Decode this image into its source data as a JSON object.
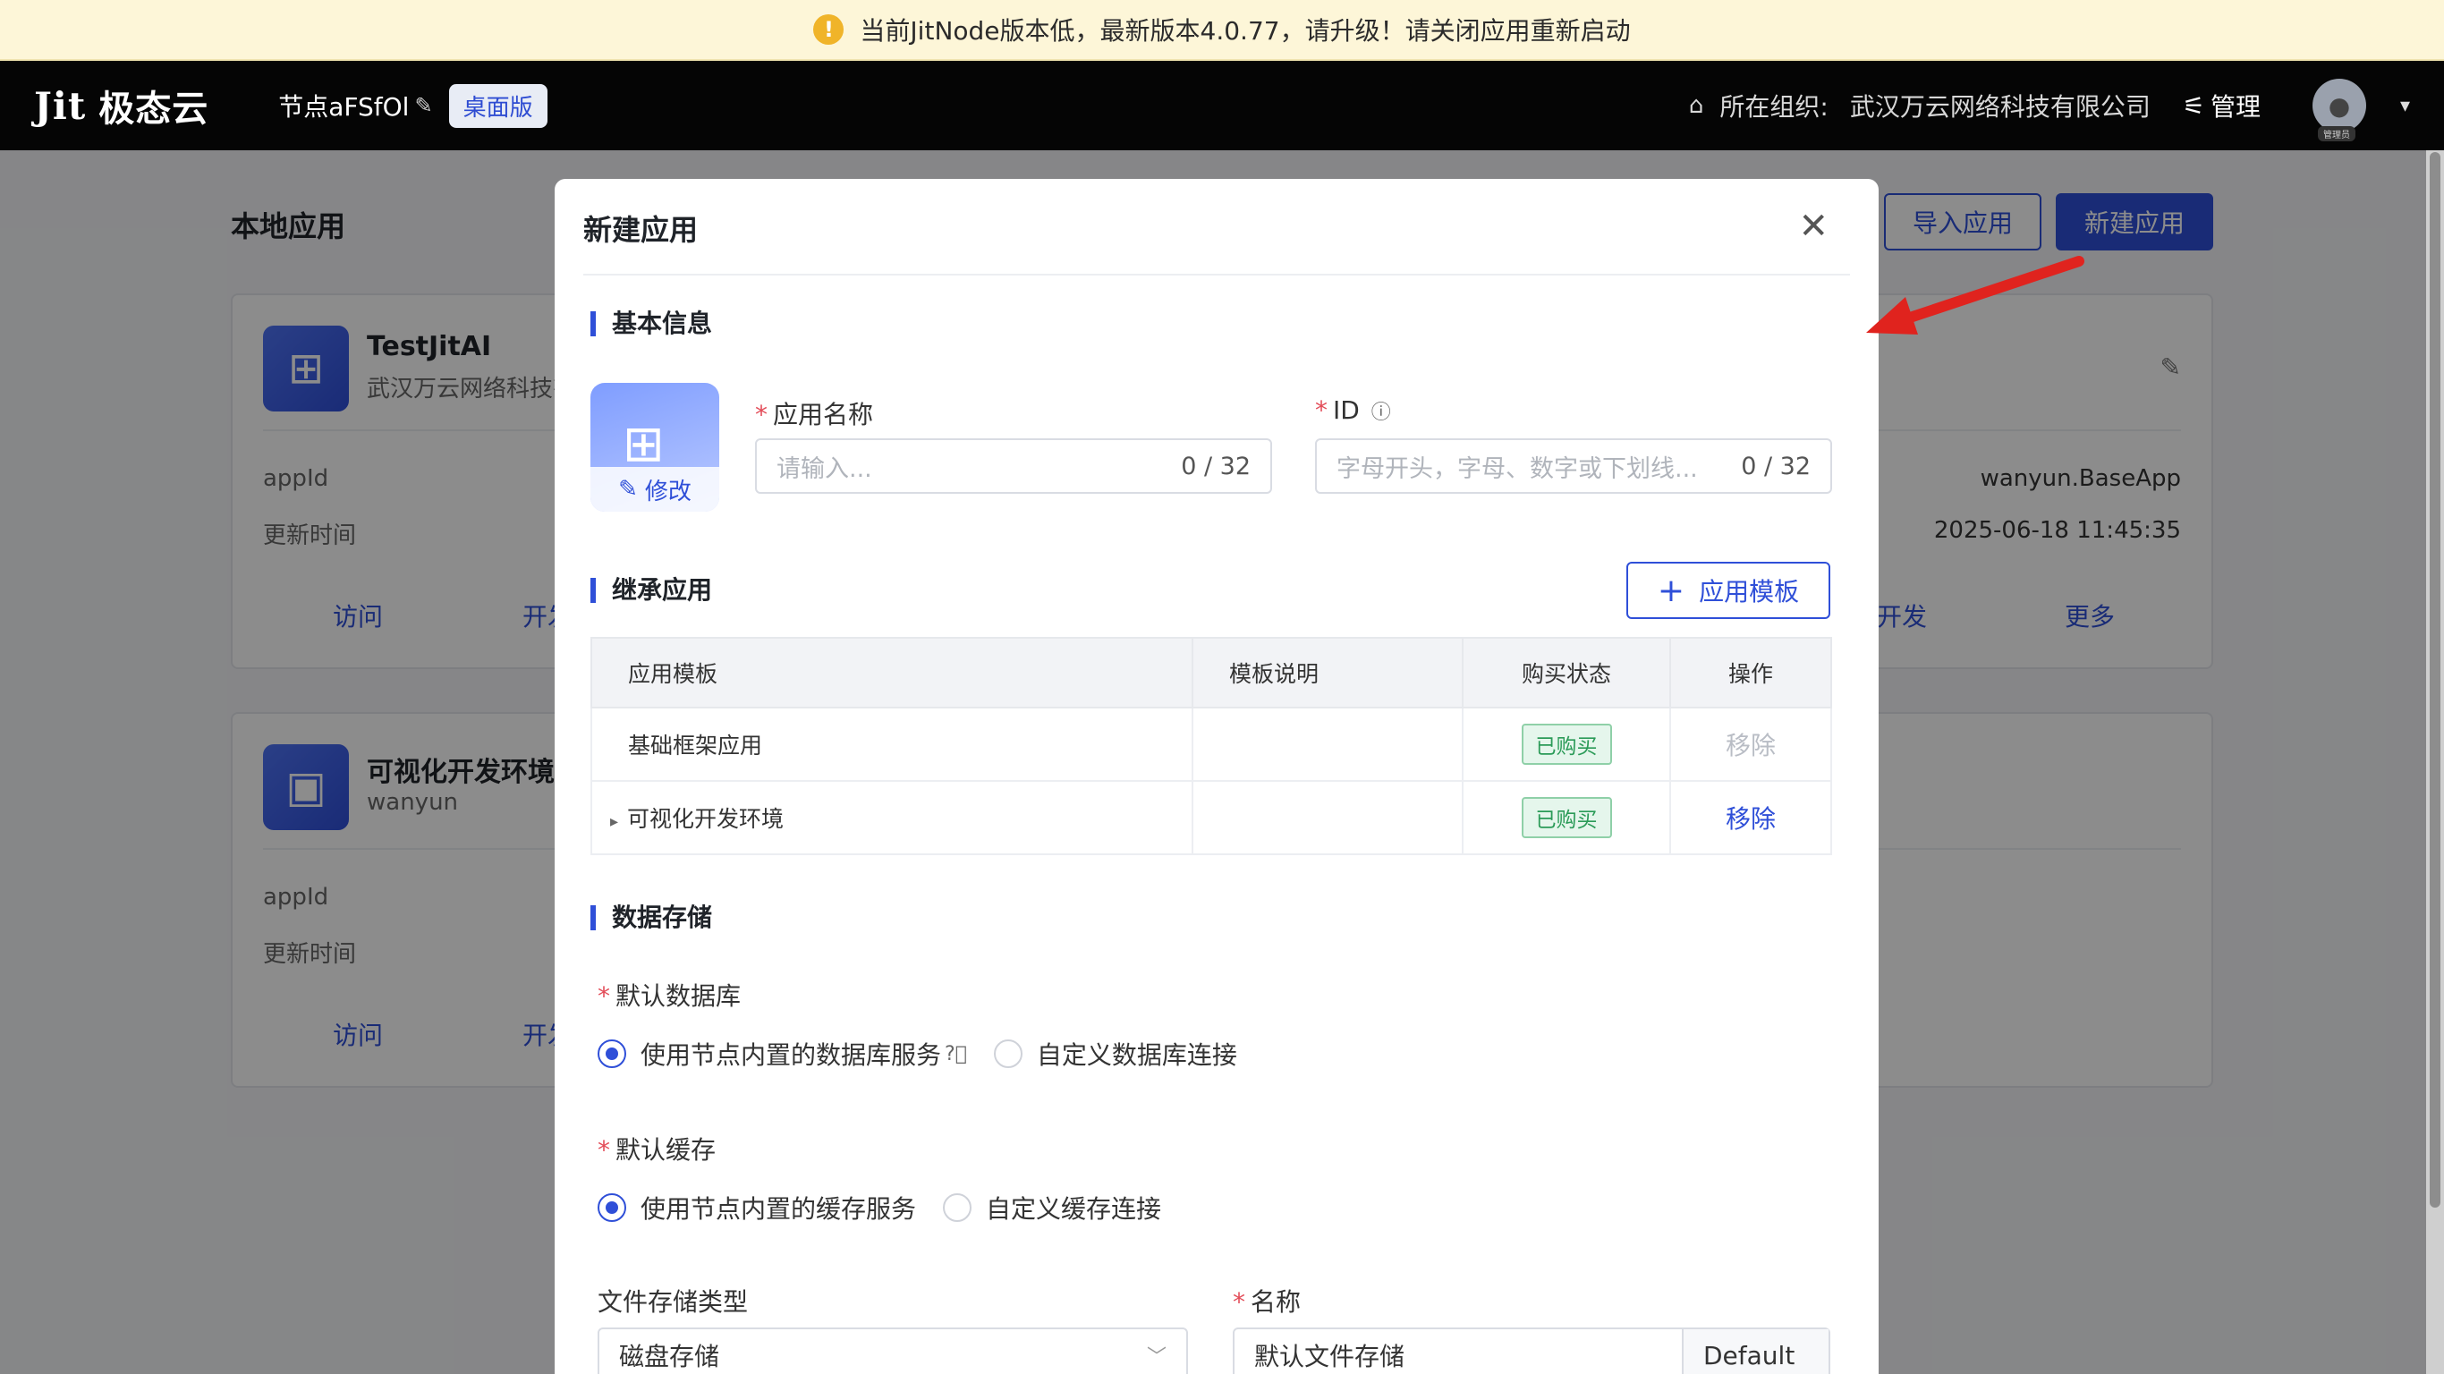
{
  "banner": {
    "text": "当前JitNode版本低，最新版本4.0.77，请升级！请关闭应用重新启动",
    "icon": "warning-icon"
  },
  "navbar": {
    "logo_mark": "Jit",
    "logo_text": "极态云",
    "node_name": "节点aFSfOl",
    "edition": "桌面版",
    "org_label": "所在组织:",
    "org_value": "武汉万云网络科技有限公司",
    "manage_label": "管理",
    "avatar_tag": "管理员"
  },
  "page": {
    "title": "本地应用",
    "import_button": "导入应用",
    "new_button": "新建应用",
    "cards": [
      {
        "name": "TestJitAI",
        "subtitle": "武汉万云网络科技有限公司",
        "appid_label": "appId",
        "appid_value": "wanyun.BaseApp",
        "updated_label": "更新时间",
        "updated_value": "2025-06-18 11:45:35",
        "actions": [
          "访问",
          "开发",
          "开发",
          "更多"
        ]
      },
      {
        "name": "可视化开发环境",
        "subtitle": "wanyun",
        "appid_label": "appId",
        "updated_label": "更新时间",
        "actions": [
          "访问",
          "开发"
        ]
      }
    ]
  },
  "modal": {
    "title": "新建应用",
    "basic_section": "基本信息",
    "logo_edit_label": "修改",
    "name_label": "应用名称",
    "name_placeholder": "请输入...",
    "name_count": "0 / 32",
    "id_label": "ID",
    "id_placeholder": "字母开头，字母、数字或下划线...",
    "id_count": "0 / 32",
    "inherit_section": "继承应用",
    "template_button": "应用模板",
    "table": {
      "headers": [
        "应用模板",
        "模板说明",
        "购买状态",
        "操作"
      ],
      "rows": [
        {
          "template": "基础框架应用",
          "desc": "",
          "status": "已购买",
          "action": "移除"
        },
        {
          "template": "可视化开发环境",
          "desc": "",
          "status": "已购买",
          "action": "移除"
        }
      ]
    },
    "storage_section": "数据存储",
    "db_label": "默认数据库",
    "db_option_builtin": "使用节点内置的数据库服务",
    "db_option_custom": "自定义数据库连接",
    "cache_label": "默认缓存",
    "cache_option_builtin": "使用节点内置的缓存服务",
    "cache_option_custom": "自定义缓存连接",
    "file_storage_label": "文件存储类型",
    "file_storage_value": "磁盘存储",
    "storage_name_label": "名称",
    "storage_name_value": "默认文件存储",
    "storage_name_suffix": "Default"
  },
  "colors": {
    "accent": "#2f4fd8",
    "danger": "#e34d59",
    "success": "#2b9b58",
    "arrow": "#e0231e"
  }
}
